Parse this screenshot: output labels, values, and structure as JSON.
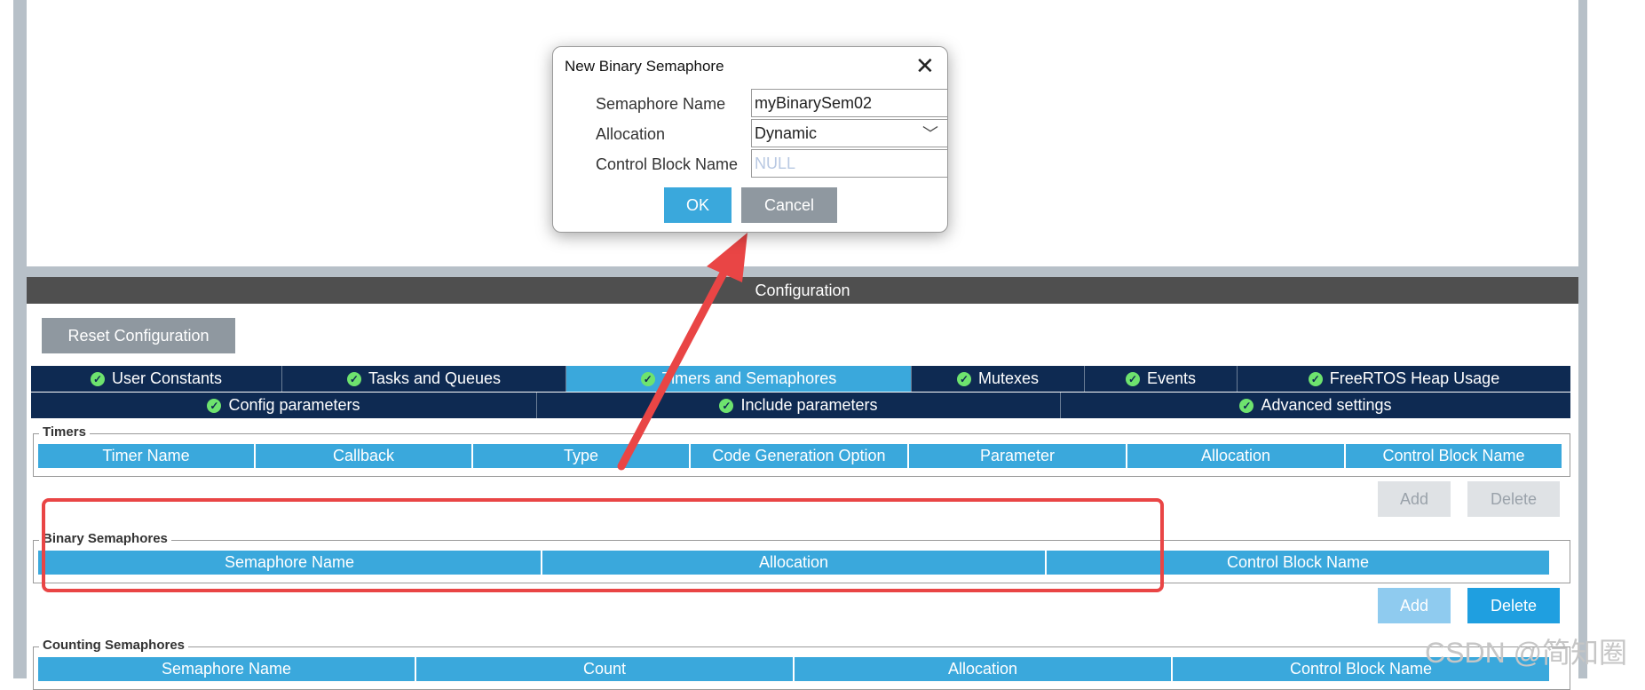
{
  "dialog": {
    "title": "New Binary Semaphore",
    "fields": {
      "semaphore_name_label": "Semaphore Name",
      "semaphore_name_value": "myBinarySem02",
      "allocation_label": "Allocation",
      "allocation_value": "Dynamic",
      "control_block_label": "Control Block Name",
      "control_block_placeholder": "NULL"
    },
    "ok_label": "OK",
    "cancel_label": "Cancel"
  },
  "config": {
    "header": "Configuration",
    "reset_label": "Reset Configuration",
    "tabs_row1": [
      "User Constants",
      "Tasks and Queues",
      "Timers and Semaphores",
      "Mutexes",
      "Events",
      "FreeRTOS Heap Usage"
    ],
    "tabs_row2": [
      "Config parameters",
      "Include parameters",
      "Advanced settings"
    ],
    "active_tab": "Timers and Semaphores"
  },
  "timers": {
    "legend": "Timers",
    "columns": [
      "Timer Name",
      "Callback",
      "Type",
      "Code Generation Option",
      "Parameter",
      "Allocation",
      "Control Block Name"
    ],
    "add_label": "Add",
    "delete_label": "Delete"
  },
  "binary_semaphores": {
    "legend": "Binary Semaphores",
    "columns": [
      "Semaphore Name",
      "Allocation",
      "Control Block Name"
    ],
    "add_label": "Add",
    "delete_label": "Delete"
  },
  "counting_semaphores": {
    "legend": "Counting Semaphores",
    "columns": [
      "Semaphore Name",
      "Count",
      "Allocation",
      "Control Block Name"
    ]
  },
  "watermark": "CSDN @简知圈",
  "colors": {
    "tab_bg": "#0e2a52",
    "tab_active": "#3aa8dc",
    "header_bg": "#4f4f4f",
    "highlight": "#e94545"
  }
}
